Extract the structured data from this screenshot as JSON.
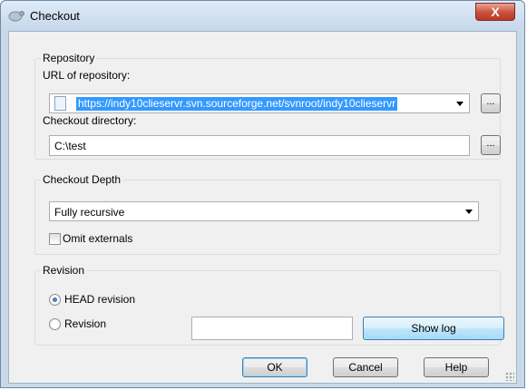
{
  "window": {
    "title": "Checkout",
    "close_label": "X"
  },
  "repository": {
    "legend": "Repository",
    "url_label": "URL of repository:",
    "url_value": "https://indy10clieservr.svn.sourceforge.net/svnroot/indy10clieservr",
    "browse_label": "...",
    "dir_label": "Checkout directory:",
    "dir_value": "C:\\test",
    "dir_browse_label": "..."
  },
  "depth": {
    "legend": "Checkout Depth",
    "selected": "Fully recursive",
    "omit_externals_label": "Omit externals",
    "omit_externals_checked": false
  },
  "revision": {
    "legend": "Revision",
    "head_label": "HEAD revision",
    "head_checked": true,
    "revision_label": "Revision",
    "revision_value": "",
    "show_log_label": "Show log"
  },
  "buttons": {
    "ok": "OK",
    "cancel": "Cancel",
    "help": "Help"
  }
}
